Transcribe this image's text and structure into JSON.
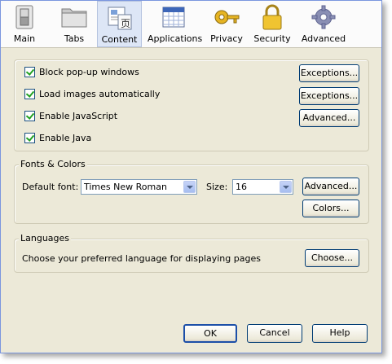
{
  "toolbar": {
    "items": [
      {
        "label": "Main",
        "icon": "switch-icon"
      },
      {
        "label": "Tabs",
        "icon": "folder-tabs-icon"
      },
      {
        "label": "Content",
        "icon": "content-page-icon"
      },
      {
        "label": "Applications",
        "icon": "applications-calendar-icon"
      },
      {
        "label": "Privacy",
        "icon": "key-mask-icon"
      },
      {
        "label": "Security",
        "icon": "padlock-icon"
      },
      {
        "label": "Advanced",
        "icon": "gear-icon"
      }
    ],
    "selected": "Content"
  },
  "content_group": {
    "block_popups": {
      "label": "Block pop-up windows",
      "checked": true
    },
    "load_images": {
      "label": "Load images automatically",
      "checked": true
    },
    "enable_js": {
      "label": "Enable JavaScript",
      "checked": true
    },
    "enable_java": {
      "label": "Enable Java",
      "checked": true
    },
    "exceptions_1": "Exceptions...",
    "exceptions_2": "Exceptions...",
    "advanced": "Advanced..."
  },
  "fonts": {
    "legend": "Fonts & Colors",
    "default_font_label": "Default font:",
    "default_font_value": "Times New Roman",
    "size_label": "Size:",
    "size_value": "16",
    "advanced": "Advanced...",
    "colors": "Colors..."
  },
  "languages": {
    "legend": "Languages",
    "description": "Choose your preferred language for displaying pages",
    "choose": "Choose..."
  },
  "footer": {
    "ok": "OK",
    "cancel": "Cancel",
    "help": "Help"
  },
  "colors": {
    "background": "#ece9d8",
    "selected_tab": "#dde6f6",
    "check": "#21a121"
  }
}
